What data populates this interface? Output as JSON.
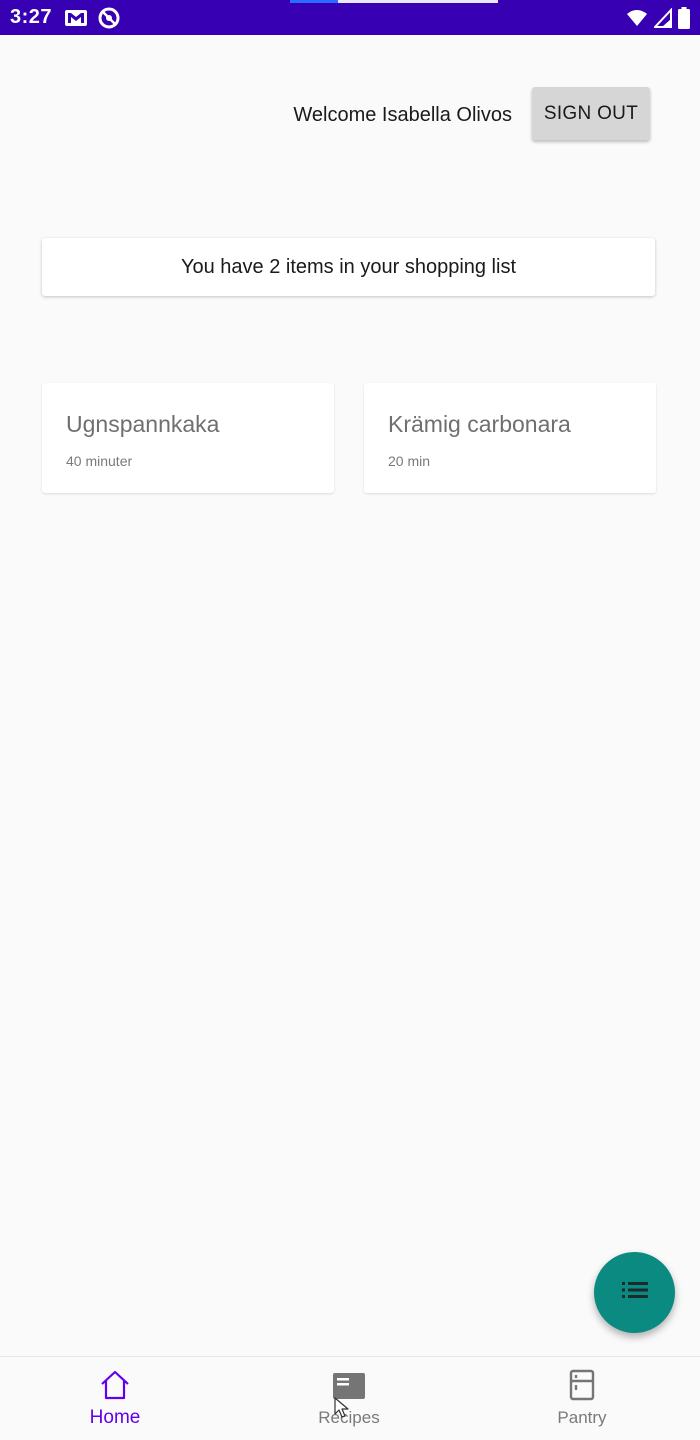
{
  "status_bar": {
    "time": "3:27",
    "background_color": "#3700b3",
    "left_icons": [
      "gmail-icon",
      "do-not-disturb-icon"
    ],
    "right_icons": [
      "wifi-icon",
      "cellular-signal-icon",
      "battery-icon"
    ]
  },
  "header": {
    "welcome_text": "Welcome Isabella Olivos",
    "sign_out_label": "SIGN OUT"
  },
  "shopping_card": {
    "text": "You have 2 items in your shopping list"
  },
  "recipes": [
    {
      "title": "Ugnspannkaka",
      "time": "40 minuter"
    },
    {
      "title": "Krämig carbonara",
      "time": "20 min"
    }
  ],
  "fab": {
    "icon": "list-icon",
    "color": "#0a8a80"
  },
  "bottom_nav": {
    "items": [
      {
        "label": "Home",
        "icon": "home-icon",
        "active": true
      },
      {
        "label": "Recipes",
        "icon": "recipes-icon",
        "active": false
      },
      {
        "label": "Pantry",
        "icon": "fridge-icon",
        "active": false
      }
    ],
    "active_color": "#6200ee",
    "inactive_color": "#7a7a7a"
  }
}
